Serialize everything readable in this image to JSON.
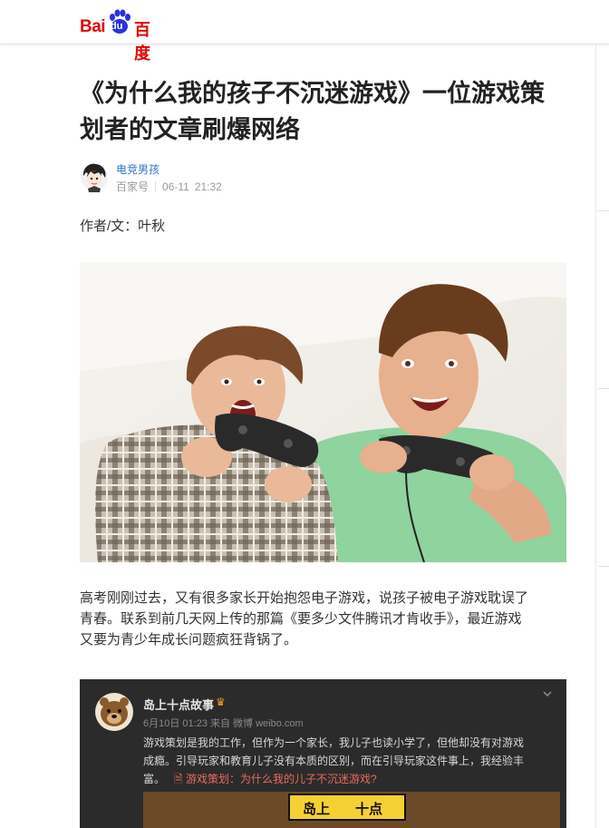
{
  "header": {
    "logo_bai": "Bai",
    "logo_du": "du",
    "logo_cn": "百度"
  },
  "article": {
    "title_line1": "《为什么我的孩子不沉迷游戏》一位游戏策",
    "title_line2": "划者的文章刷爆网络",
    "author": {
      "name": "电竞男孩",
      "source": "百家号",
      "date": "06-11",
      "time": "21:32"
    },
    "byline": "作者/文：叶秋",
    "paragraph_line1": "高考刚刚过去，又有很多家长开始抱怨电子游戏，说孩子被电子游戏耽误了",
    "paragraph_line2": "青春。联系到前几天网上传的那篇《要多少文件腾讯才肯收手》，最近游戏",
    "paragraph_line3": "又要为青少年成长问题疯狂背锅了。"
  },
  "weibo_card": {
    "account_name": "岛上十点故事",
    "meta": "6月10日 01:23 来自 微博 weibo.com",
    "text_line1": "游戏策划是我的工作，但作为一个家长，我儿子也读小学了，但他却没有对游戏",
    "text_line2": "成瘾。引导玩家和教育儿子没有本质的区别，而在引导玩家这件事上，我经验丰",
    "text_line3_prefix": "富。",
    "link_text": "游戏策划：为什么我的儿子不沉迷游戏?",
    "banner_left": "岛上",
    "banner_right": "十点"
  },
  "colors": {
    "brand_red": "#e10602",
    "brand_blue": "#2932e1",
    "link_blue": "#3072c4",
    "weibo_bg": "#2b2b2b",
    "weibo_link": "#e86c5c"
  }
}
